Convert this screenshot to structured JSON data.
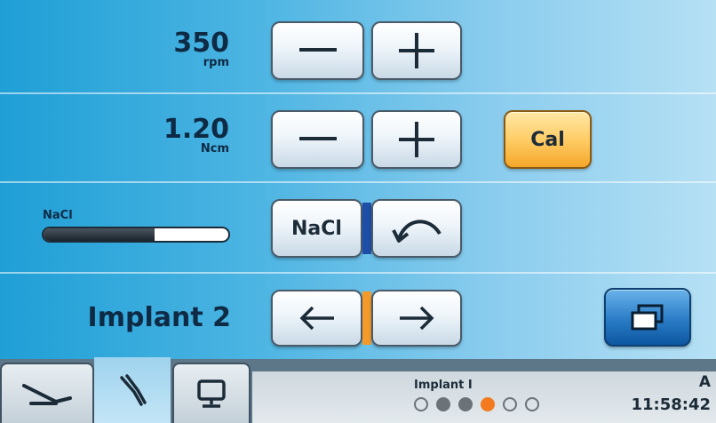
{
  "speed": {
    "value": "350",
    "unit": "rpm"
  },
  "torque": {
    "value": "1.20",
    "unit": "Ncm"
  },
  "cal_button": "Cal",
  "coolant": {
    "label": "NaCl",
    "button": "NaCl",
    "level_fraction": 0.6
  },
  "program": {
    "name": "Implant 2"
  },
  "status": {
    "program_name": "Implant I",
    "dots": [
      "empty",
      "filled",
      "filled",
      "active",
      "empty",
      "empty"
    ],
    "letter": "A",
    "time": "11:58:42"
  },
  "colors": {
    "active_dot": "#f47a20",
    "filled_dot": "#6b7278",
    "orange_bar": "#f39a2b",
    "blue_bar": "#1d4fa8"
  },
  "icons": {
    "minus": "minus-icon",
    "plus": "plus-icon",
    "rotate": "rotate-direction-icon",
    "left": "arrow-left-icon",
    "right": "arrow-right-icon",
    "windows": "windows-icon",
    "handpiece": "handpiece-icon",
    "instrument": "instrument-icon",
    "monitor": "monitor-icon"
  }
}
